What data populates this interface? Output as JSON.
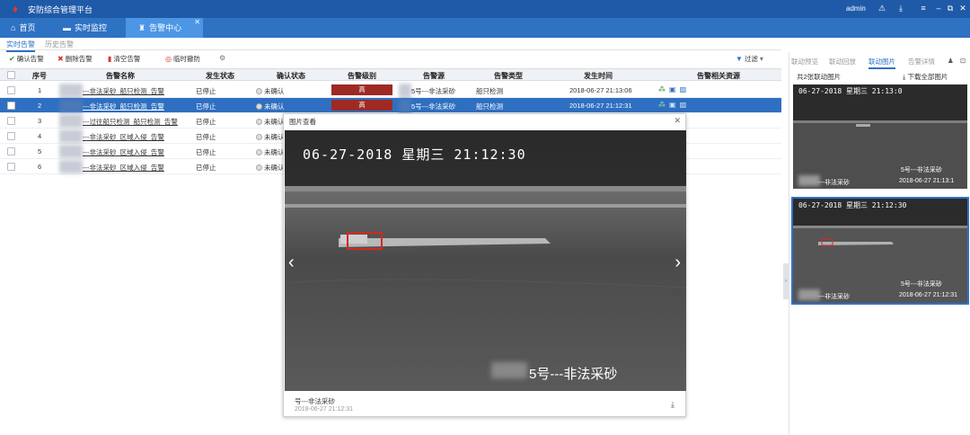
{
  "app": {
    "title": "安防综合管理平台",
    "user": "admin"
  },
  "nav": {
    "tabs": [
      {
        "label": "首页"
      },
      {
        "label": "实时监控"
      },
      {
        "label": "告警中心"
      }
    ]
  },
  "subtabs": [
    "实时告警",
    "历史告警"
  ],
  "toolbar": {
    "confirm": "确认告警",
    "delete": "删除告警",
    "clear": "清空告警",
    "track": "临时撤防",
    "filter": "过滤"
  },
  "table": {
    "headers": [
      "序号",
      "告警名称",
      "发生状态",
      "确认状态",
      "告警级别",
      "告警源",
      "告警类型",
      "发生时间",
      "告警相关资源"
    ],
    "rows": [
      {
        "no": "1",
        "name": "---非法采砂_船只检测_告警",
        "state": "已停止",
        "confirm": "未确认",
        "level": "高",
        "source": "5号---非法采砂",
        "type": "船只检测",
        "time": "2018-06-27 21:13:06"
      },
      {
        "no": "2",
        "name": "---非法采砂_船只检测_告警",
        "state": "已停止",
        "confirm": "未确认",
        "level": "高",
        "source": "5号---非法采砂",
        "type": "船只检测",
        "time": "2018-06-27 21:12:31"
      },
      {
        "no": "3",
        "name": "---过往船只检测_船只检测_告警",
        "state": "已停止",
        "confirm": "未确认"
      },
      {
        "no": "4",
        "name": "---非法采砂_区域入侵_告警",
        "state": "已停止",
        "confirm": "未确认"
      },
      {
        "no": "5",
        "name": "---非法采砂_区域入侵_告警",
        "state": "已停止",
        "confirm": "未确认"
      },
      {
        "no": "6",
        "name": "---非法采砂_区域入侵_告警",
        "state": "已停止",
        "confirm": "未确认"
      }
    ]
  },
  "viewer": {
    "title": "图片查看",
    "ocr_date": "06-27-2018  星期三  21:12:30",
    "ocr_channel": "5号---非法采砂",
    "caption": "号---非法采砂",
    "caption_time": "2018-06-27 21:12:31"
  },
  "right": {
    "tabs": [
      "联动预览",
      "联动回放",
      "联动图片",
      "告警详情"
    ],
    "count": "共2张联动图片",
    "download_all": "下载全部图片",
    "thumbs": [
      {
        "date": "06-27-2018 星期三 21:13:0",
        "channel": "5号---非法采砂",
        "name": "---非法采砂",
        "time": "2018-06-27 21:13:1"
      },
      {
        "date": "06-27-2018 星期三 21:12:30",
        "channel": "5号---非法采砂",
        "name": "---非法采砂",
        "time": "2018-06-27 21:12:31"
      }
    ]
  }
}
